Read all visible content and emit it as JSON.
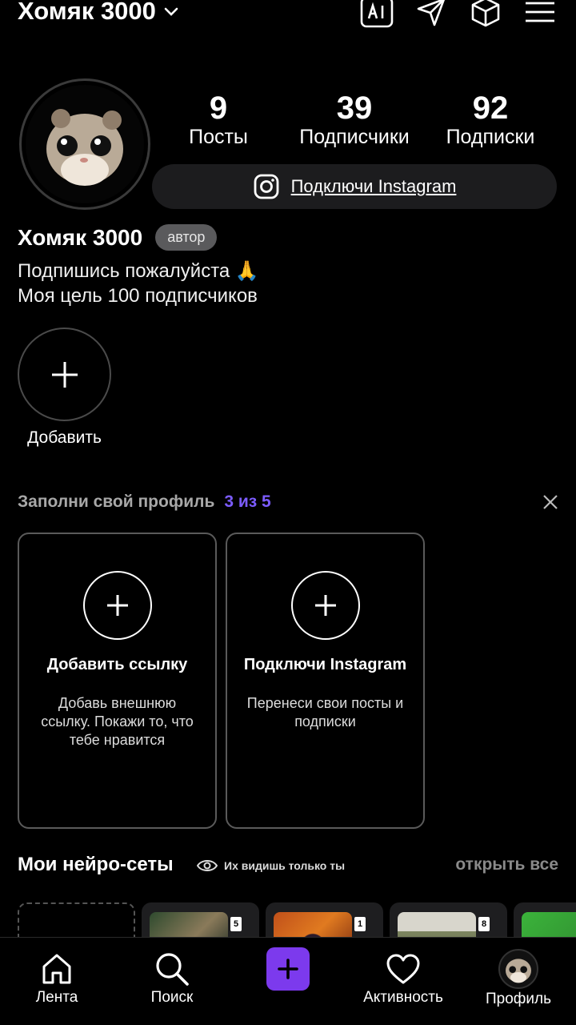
{
  "header": {
    "title": "Хомяк 3000",
    "icons": [
      "chevron-down-icon",
      "ai-icon",
      "send-icon",
      "box-icon",
      "menu-icon"
    ]
  },
  "profile": {
    "stats": [
      {
        "value": "9",
        "label": "Посты"
      },
      {
        "value": "39",
        "label": "Подписчики"
      },
      {
        "value": "92",
        "label": "Подписки"
      }
    ],
    "instagram_connect": "Подключи Instagram",
    "name": "Хомяк 3000",
    "badge": "автор",
    "bio_line1": "Подпишись пожалуйста 🙏",
    "bio_line2": "Моя цель 100 подписчиков"
  },
  "story": {
    "add_label": "Добавить"
  },
  "fill_profile": {
    "title": "Заполни свой профиль",
    "progress": "3 из 5",
    "cards": [
      {
        "title": "Добавить ссылку",
        "desc": "Добавь внешнюю ссылку. Покажи то, что тебе нравится"
      },
      {
        "title": "Подключи Instagram",
        "desc": "Перенеси свои посты и подписки"
      }
    ]
  },
  "neuro_nets": {
    "title": "Мои нейро-сеты",
    "private_note": "Их видишь только ты",
    "open_all": "открыть все",
    "thumb_counts": [
      "5",
      "1",
      "8"
    ]
  },
  "bottom_nav": {
    "feed": "Лента",
    "search": "Поиск",
    "activity": "Активность",
    "profile": "Профиль"
  },
  "colors": {
    "background": "#000000",
    "accent": "#7c3aed",
    "progress": "#7c5cff",
    "surface": "#1c1c1e"
  }
}
